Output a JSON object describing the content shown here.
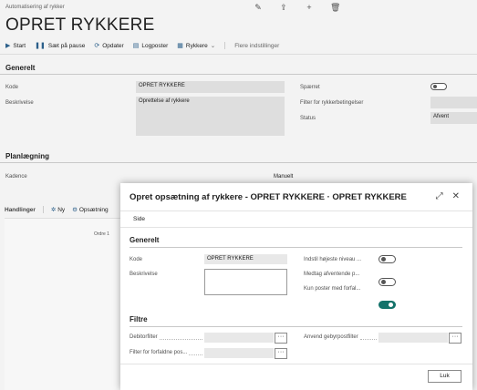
{
  "page": {
    "breadcrumb": "Automatisering af rykker",
    "title": "OPRET RYKKERE",
    "top_icons": [
      "pencil-icon",
      "share-icon",
      "plus-icon",
      "trash-icon"
    ]
  },
  "actions": {
    "start": "Start",
    "pause": "Sæt på pause",
    "update": "Opdater",
    "log": "Logposter",
    "reminders": "Rykkere",
    "more": "Flere indstillinger"
  },
  "generelt": {
    "title": "Generelt",
    "kode_label": "Kode",
    "kode_value": "OPRET RYKKERE",
    "beskrivelse_label": "Beskrivelse",
    "beskrivelse_value": "Oprettelse af rykkere",
    "spaerret_label": "Spærret",
    "filter_label": "Filter for rykkerbetingelser",
    "status_label": "Status",
    "status_value": "Afvent"
  },
  "planlaegning": {
    "title": "Planlægning",
    "kadence_label": "Kadence",
    "kadence_value": "Manuelt"
  },
  "handlinger": {
    "title": "Handlinger",
    "new": "Ny",
    "setup": "Opsætning",
    "column": "Ordre 1"
  },
  "dialog": {
    "title": "Opret opsætning af rykkere - OPRET RYKKERE · OPRET RYKKERE",
    "tab": "Side",
    "general_title": "Generelt",
    "kode_label": "Kode",
    "kode_value": "OPRET RYKKERE",
    "beskrivelse_label": "Beskrivelse",
    "toggle1_label": "Indstil højeste niveau ...",
    "toggle2_label": "Medtag afventende p...",
    "toggle3_label": "Kun poster med forfal...",
    "toggle_states": [
      false,
      false,
      true
    ],
    "filters_title": "Filtre",
    "debitor_label": "Debitorfilter",
    "forfaldne_label": "Filter for forfaldne pos...",
    "gebyr_label": "Anvend gebyrpostfilter",
    "dots": "···",
    "close_label": "Luk"
  },
  "colors": {
    "accent": "#13726a",
    "icon_blue": "#2b5f8a"
  }
}
